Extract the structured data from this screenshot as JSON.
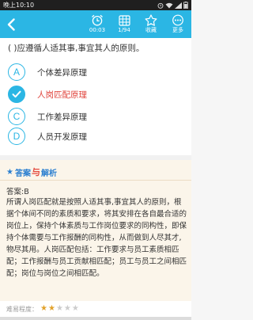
{
  "status_bar": {
    "time": "晚上10:10"
  },
  "toolbar": {
    "items": [
      {
        "icon": "alarm-clock-icon",
        "label": "00:03"
      },
      {
        "icon": "card-grid-icon",
        "label": "1/94"
      },
      {
        "icon": "star-icon",
        "label": "收藏"
      },
      {
        "icon": "more-icon",
        "label": "更多"
      }
    ],
    "accent": "#2bb6e4"
  },
  "question": {
    "text": "(     )应遵循人适其事,事宜其人的原则。",
    "options": [
      {
        "letter": "A",
        "text": "个体差异原理",
        "selected": false
      },
      {
        "letter": "B",
        "text": "人岗匹配原理",
        "selected": true
      },
      {
        "letter": "C",
        "text": "工作差异原理",
        "selected": false
      },
      {
        "letter": "D",
        "text": "人员开发原理",
        "selected": false
      }
    ]
  },
  "answer_section": {
    "title_left": "答案",
    "title_mid": "与",
    "title_right": "解析",
    "answer_label": "答案:B",
    "explanation": "所谓人岗匹配就是按照人适其事,事宜其人的原则，根据个体间不同的素质和要求，将其安排在各自最合适的岗位上，保持个体素质与工作岗位要求的同构性，即保持个体需要与工作报酬的同构性，从而做到人尽其才,物尽其用。人岗匹配包括：工作要求与员工素质相匹配；工作报酬与员工贡献相匹配；员工与员工之间相匹配；岗位与岗位之间相匹配。",
    "difficulty_label": "难易程度：",
    "difficulty_rating": 2,
    "difficulty_max": 5
  },
  "colors": {
    "selected_text": "#e0443c",
    "section_bg": "#fbf5ea",
    "star_on": "#e2a22a"
  }
}
